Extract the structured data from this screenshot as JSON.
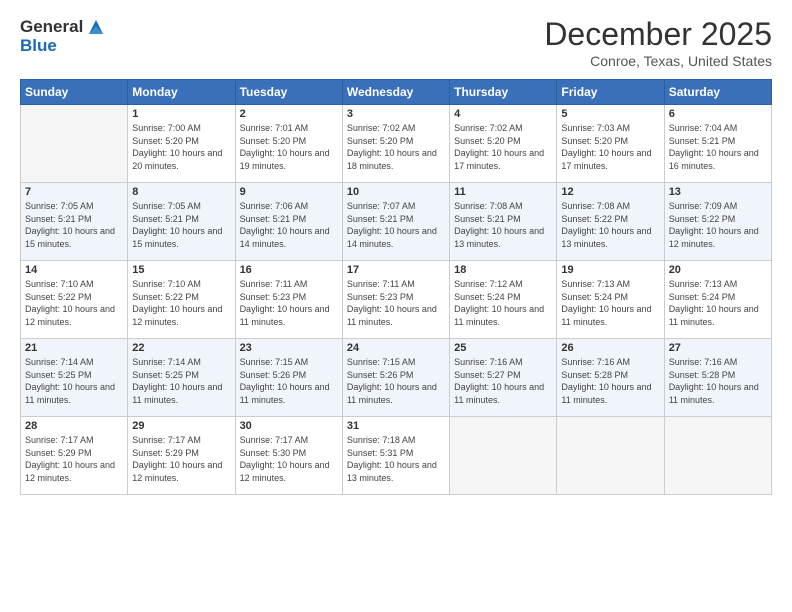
{
  "logo": {
    "general": "General",
    "blue": "Blue"
  },
  "header": {
    "title": "December 2025",
    "subtitle": "Conroe, Texas, United States"
  },
  "weekdays": [
    "Sunday",
    "Monday",
    "Tuesday",
    "Wednesday",
    "Thursday",
    "Friday",
    "Saturday"
  ],
  "weeks": [
    [
      {
        "day": "",
        "empty": true
      },
      {
        "day": "1",
        "sunrise": "7:00 AM",
        "sunset": "5:20 PM",
        "daylight": "10 hours and 20 minutes."
      },
      {
        "day": "2",
        "sunrise": "7:01 AM",
        "sunset": "5:20 PM",
        "daylight": "10 hours and 19 minutes."
      },
      {
        "day": "3",
        "sunrise": "7:02 AM",
        "sunset": "5:20 PM",
        "daylight": "10 hours and 18 minutes."
      },
      {
        "day": "4",
        "sunrise": "7:02 AM",
        "sunset": "5:20 PM",
        "daylight": "10 hours and 17 minutes."
      },
      {
        "day": "5",
        "sunrise": "7:03 AM",
        "sunset": "5:20 PM",
        "daylight": "10 hours and 17 minutes."
      },
      {
        "day": "6",
        "sunrise": "7:04 AM",
        "sunset": "5:21 PM",
        "daylight": "10 hours and 16 minutes."
      }
    ],
    [
      {
        "day": "7",
        "sunrise": "7:05 AM",
        "sunset": "5:21 PM",
        "daylight": "10 hours and 15 minutes."
      },
      {
        "day": "8",
        "sunrise": "7:05 AM",
        "sunset": "5:21 PM",
        "daylight": "10 hours and 15 minutes."
      },
      {
        "day": "9",
        "sunrise": "7:06 AM",
        "sunset": "5:21 PM",
        "daylight": "10 hours and 14 minutes."
      },
      {
        "day": "10",
        "sunrise": "7:07 AM",
        "sunset": "5:21 PM",
        "daylight": "10 hours and 14 minutes."
      },
      {
        "day": "11",
        "sunrise": "7:08 AM",
        "sunset": "5:21 PM",
        "daylight": "10 hours and 13 minutes."
      },
      {
        "day": "12",
        "sunrise": "7:08 AM",
        "sunset": "5:22 PM",
        "daylight": "10 hours and 13 minutes."
      },
      {
        "day": "13",
        "sunrise": "7:09 AM",
        "sunset": "5:22 PM",
        "daylight": "10 hours and 12 minutes."
      }
    ],
    [
      {
        "day": "14",
        "sunrise": "7:10 AM",
        "sunset": "5:22 PM",
        "daylight": "10 hours and 12 minutes."
      },
      {
        "day": "15",
        "sunrise": "7:10 AM",
        "sunset": "5:22 PM",
        "daylight": "10 hours and 12 minutes."
      },
      {
        "day": "16",
        "sunrise": "7:11 AM",
        "sunset": "5:23 PM",
        "daylight": "10 hours and 11 minutes."
      },
      {
        "day": "17",
        "sunrise": "7:11 AM",
        "sunset": "5:23 PM",
        "daylight": "10 hours and 11 minutes."
      },
      {
        "day": "18",
        "sunrise": "7:12 AM",
        "sunset": "5:24 PM",
        "daylight": "10 hours and 11 minutes."
      },
      {
        "day": "19",
        "sunrise": "7:13 AM",
        "sunset": "5:24 PM",
        "daylight": "10 hours and 11 minutes."
      },
      {
        "day": "20",
        "sunrise": "7:13 AM",
        "sunset": "5:24 PM",
        "daylight": "10 hours and 11 minutes."
      }
    ],
    [
      {
        "day": "21",
        "sunrise": "7:14 AM",
        "sunset": "5:25 PM",
        "daylight": "10 hours and 11 minutes."
      },
      {
        "day": "22",
        "sunrise": "7:14 AM",
        "sunset": "5:25 PM",
        "daylight": "10 hours and 11 minutes."
      },
      {
        "day": "23",
        "sunrise": "7:15 AM",
        "sunset": "5:26 PM",
        "daylight": "10 hours and 11 minutes."
      },
      {
        "day": "24",
        "sunrise": "7:15 AM",
        "sunset": "5:26 PM",
        "daylight": "10 hours and 11 minutes."
      },
      {
        "day": "25",
        "sunrise": "7:16 AM",
        "sunset": "5:27 PM",
        "daylight": "10 hours and 11 minutes."
      },
      {
        "day": "26",
        "sunrise": "7:16 AM",
        "sunset": "5:28 PM",
        "daylight": "10 hours and 11 minutes."
      },
      {
        "day": "27",
        "sunrise": "7:16 AM",
        "sunset": "5:28 PM",
        "daylight": "10 hours and 11 minutes."
      }
    ],
    [
      {
        "day": "28",
        "sunrise": "7:17 AM",
        "sunset": "5:29 PM",
        "daylight": "10 hours and 12 minutes."
      },
      {
        "day": "29",
        "sunrise": "7:17 AM",
        "sunset": "5:29 PM",
        "daylight": "10 hours and 12 minutes."
      },
      {
        "day": "30",
        "sunrise": "7:17 AM",
        "sunset": "5:30 PM",
        "daylight": "10 hours and 12 minutes."
      },
      {
        "day": "31",
        "sunrise": "7:18 AM",
        "sunset": "5:31 PM",
        "daylight": "10 hours and 13 minutes."
      },
      {
        "day": "",
        "empty": true
      },
      {
        "day": "",
        "empty": true
      },
      {
        "day": "",
        "empty": true
      }
    ]
  ],
  "labels": {
    "sunrise": "Sunrise:",
    "sunset": "Sunset:",
    "daylight": "Daylight:"
  }
}
